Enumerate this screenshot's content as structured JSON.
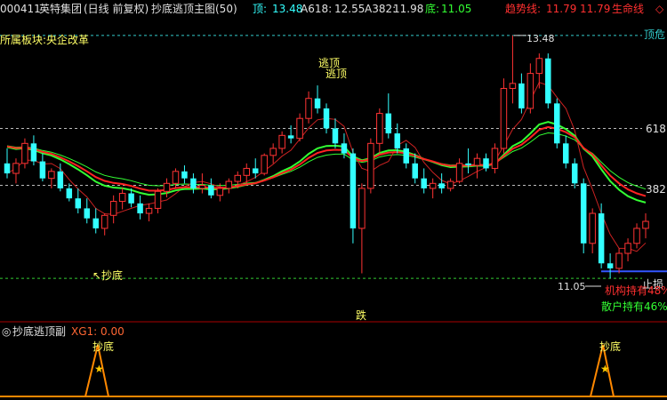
{
  "header": {
    "stock_code": "000411",
    "stock_name": "英特集团",
    "period": "(日线 前复权)",
    "indicator": "抄底逃顶主图(50)",
    "ding_label": "顶:",
    "ding_value": "13.48",
    "a618_label": "A618:",
    "a618_value": "12.55",
    "a382_label": "A382:",
    "a382_value": "11.98",
    "di_label": "底:",
    "di_value": "11.05",
    "trend_label": "趋势线:",
    "trend_value": "11.79",
    "trend_value2": "11.79",
    "life_label": "生命线",
    "diamond": "◇"
  },
  "sector": "所属板块:央企改革",
  "main": {
    "annotations": {
      "escape_top_1": "逃顶",
      "escape_top_2": "逃顶",
      "buy_bottom": "↖抄底",
      "high_price": "13.48",
      "low_price": "11.05",
      "fall": "跌"
    },
    "right_labels": {
      "ding_wei": "顶危",
      "l618": "618",
      "l382": "382",
      "di_sun": "止损",
      "inst_hold": "机构持有48%",
      "retail_hold": "散户持有46%"
    }
  },
  "sub": {
    "title": "抄底逃顶副",
    "xg_label": "XG1: 0.00",
    "signal_1": "抄底",
    "signal_2": "抄底"
  },
  "chart_data": {
    "type": "candlestick",
    "y_axis": {
      "min": 10.9,
      "max": 13.55,
      "levels": {
        "ding": 13.48,
        "a618": 12.55,
        "a382": 11.98,
        "di": 11.05
      }
    },
    "candles": [
      {
        "o": 12.2,
        "h": 12.35,
        "l": 12.05,
        "c": 12.1
      },
      {
        "o": 12.1,
        "h": 12.25,
        "l": 12.0,
        "c": 12.2
      },
      {
        "o": 12.2,
        "h": 12.45,
        "l": 12.15,
        "c": 12.4
      },
      {
        "o": 12.4,
        "h": 12.48,
        "l": 12.18,
        "c": 12.22
      },
      {
        "o": 12.22,
        "h": 12.3,
        "l": 12.02,
        "c": 12.05
      },
      {
        "o": 12.05,
        "h": 12.15,
        "l": 11.95,
        "c": 12.12
      },
      {
        "o": 12.12,
        "h": 12.2,
        "l": 11.92,
        "c": 11.95
      },
      {
        "o": 11.95,
        "h": 12.0,
        "l": 11.82,
        "c": 11.85
      },
      {
        "o": 11.85,
        "h": 11.95,
        "l": 11.7,
        "c": 11.75
      },
      {
        "o": 11.75,
        "h": 11.85,
        "l": 11.6,
        "c": 11.65
      },
      {
        "o": 11.65,
        "h": 11.75,
        "l": 11.5,
        "c": 11.55
      },
      {
        "o": 11.55,
        "h": 11.7,
        "l": 11.48,
        "c": 11.68
      },
      {
        "o": 11.68,
        "h": 11.88,
        "l": 11.6,
        "c": 11.82
      },
      {
        "o": 11.82,
        "h": 11.96,
        "l": 11.74,
        "c": 11.9
      },
      {
        "o": 11.9,
        "h": 11.95,
        "l": 11.76,
        "c": 11.8
      },
      {
        "o": 11.8,
        "h": 11.88,
        "l": 11.64,
        "c": 11.7
      },
      {
        "o": 11.7,
        "h": 11.8,
        "l": 11.62,
        "c": 11.75
      },
      {
        "o": 11.75,
        "h": 11.95,
        "l": 11.7,
        "c": 11.92
      },
      {
        "o": 11.92,
        "h": 12.05,
        "l": 11.86,
        "c": 12.0
      },
      {
        "o": 12.0,
        "h": 12.15,
        "l": 11.95,
        "c": 12.12
      },
      {
        "o": 12.12,
        "h": 12.18,
        "l": 12.0,
        "c": 12.05
      },
      {
        "o": 12.05,
        "h": 12.1,
        "l": 11.9,
        "c": 11.95
      },
      {
        "o": 11.95,
        "h": 12.1,
        "l": 11.9,
        "c": 11.98
      },
      {
        "o": 11.98,
        "h": 12.05,
        "l": 11.85,
        "c": 11.88
      },
      {
        "o": 11.88,
        "h": 12.0,
        "l": 11.82,
        "c": 11.95
      },
      {
        "o": 11.95,
        "h": 12.05,
        "l": 11.9,
        "c": 12.02
      },
      {
        "o": 12.02,
        "h": 12.12,
        "l": 11.95,
        "c": 12.08
      },
      {
        "o": 12.08,
        "h": 12.2,
        "l": 12.0,
        "c": 12.15
      },
      {
        "o": 12.15,
        "h": 12.25,
        "l": 12.05,
        "c": 12.1
      },
      {
        "o": 12.1,
        "h": 12.3,
        "l": 12.08,
        "c": 12.28
      },
      {
        "o": 12.28,
        "h": 12.4,
        "l": 12.2,
        "c": 12.35
      },
      {
        "o": 12.35,
        "h": 12.52,
        "l": 12.3,
        "c": 12.48
      },
      {
        "o": 12.48,
        "h": 12.58,
        "l": 12.4,
        "c": 12.45
      },
      {
        "o": 12.45,
        "h": 12.7,
        "l": 12.42,
        "c": 12.65
      },
      {
        "o": 12.65,
        "h": 12.92,
        "l": 12.6,
        "c": 12.85
      },
      {
        "o": 12.85,
        "h": 12.98,
        "l": 12.7,
        "c": 12.75
      },
      {
        "o": 12.75,
        "h": 12.8,
        "l": 12.5,
        "c": 12.55
      },
      {
        "o": 12.55,
        "h": 12.65,
        "l": 12.35,
        "c": 12.4
      },
      {
        "o": 12.4,
        "h": 12.5,
        "l": 12.25,
        "c": 12.3
      },
      {
        "o": 12.3,
        "h": 12.35,
        "l": 11.4,
        "c": 11.55
      },
      {
        "o": 11.55,
        "h": 12.0,
        "l": 11.1,
        "c": 11.95
      },
      {
        "o": 11.95,
        "h": 12.45,
        "l": 11.9,
        "c": 12.4
      },
      {
        "o": 12.4,
        "h": 12.75,
        "l": 12.3,
        "c": 12.7
      },
      {
        "o": 12.7,
        "h": 12.9,
        "l": 12.45,
        "c": 12.5
      },
      {
        "o": 12.5,
        "h": 12.6,
        "l": 12.3,
        "c": 12.35
      },
      {
        "o": 12.35,
        "h": 12.4,
        "l": 12.15,
        "c": 12.2
      },
      {
        "o": 12.2,
        "h": 12.3,
        "l": 12.0,
        "c": 12.05
      },
      {
        "o": 12.05,
        "h": 12.15,
        "l": 11.9,
        "c": 11.95
      },
      {
        "o": 11.95,
        "h": 12.05,
        "l": 11.85,
        "c": 12.0
      },
      {
        "o": 12.0,
        "h": 12.1,
        "l": 11.9,
        "c": 11.95
      },
      {
        "o": 11.95,
        "h": 12.05,
        "l": 11.92,
        "c": 12.02
      },
      {
        "o": 12.02,
        "h": 12.25,
        "l": 12.0,
        "c": 12.2
      },
      {
        "o": 12.2,
        "h": 12.35,
        "l": 12.1,
        "c": 12.18
      },
      {
        "o": 12.18,
        "h": 12.3,
        "l": 12.05,
        "c": 12.25
      },
      {
        "o": 12.25,
        "h": 12.3,
        "l": 12.12,
        "c": 12.15
      },
      {
        "o": 12.15,
        "h": 12.4,
        "l": 12.1,
        "c": 12.35
      },
      {
        "o": 12.35,
        "h": 13.05,
        "l": 12.3,
        "c": 12.95
      },
      {
        "o": 12.95,
        "h": 13.48,
        "l": 12.8,
        "c": 13.0
      },
      {
        "o": 13.0,
        "h": 13.1,
        "l": 12.7,
        "c": 12.75
      },
      {
        "o": 12.75,
        "h": 13.2,
        "l": 12.7,
        "c": 13.1
      },
      {
        "o": 13.1,
        "h": 13.3,
        "l": 12.95,
        "c": 13.25
      },
      {
        "o": 13.25,
        "h": 13.3,
        "l": 12.75,
        "c": 12.8
      },
      {
        "o": 12.8,
        "h": 12.85,
        "l": 12.35,
        "c": 12.4
      },
      {
        "o": 12.4,
        "h": 12.48,
        "l": 12.15,
        "c": 12.2
      },
      {
        "o": 12.2,
        "h": 12.25,
        "l": 11.95,
        "c": 12.0
      },
      {
        "o": 12.0,
        "h": 12.05,
        "l": 11.3,
        "c": 11.4
      },
      {
        "o": 11.4,
        "h": 11.75,
        "l": 11.3,
        "c": 11.7
      },
      {
        "o": 11.7,
        "h": 11.8,
        "l": 11.15,
        "c": 11.2
      },
      {
        "o": 11.2,
        "h": 11.3,
        "l": 11.05,
        "c": 11.15
      },
      {
        "o": 11.15,
        "h": 11.35,
        "l": 11.1,
        "c": 11.3
      },
      {
        "o": 11.3,
        "h": 11.45,
        "l": 11.22,
        "c": 11.4
      },
      {
        "o": 11.4,
        "h": 11.6,
        "l": 11.35,
        "c": 11.55
      },
      {
        "o": 11.55,
        "h": 11.7,
        "l": 11.45,
        "c": 11.62
      }
    ]
  }
}
